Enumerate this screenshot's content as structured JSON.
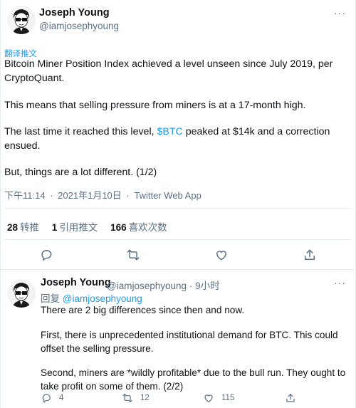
{
  "colors": {
    "link": "#1d9bf0",
    "secondary_text": "#5b7083",
    "divider": "#e6ecf0"
  },
  "main_tweet": {
    "author_name": "Joseph Young",
    "author_handle": "@iamjosephyoung",
    "translate_label": "翻译推文",
    "text_line1": "Bitcoin Miner Position Index achieved a level unseen since July 2019, per CryptoQuant.",
    "text_line2": "This means that selling pressure from miners is at a 17-month high.",
    "text_line3_before": "The last time it reached this level, ",
    "text_line3_link": "$BTC",
    "text_line3_after": " peaked at $14k and a correction ensued.",
    "text_line4": "But, things are a lot different. (1/2)",
    "time": "下午11:14",
    "date": "2021年1月10日",
    "source": "Twitter Web App",
    "meta_separator": "·",
    "stats": [
      {
        "count": "28",
        "label": "转推"
      },
      {
        "count": "1",
        "label": "引用推文"
      },
      {
        "count": "166",
        "label": "喜欢次数"
      }
    ],
    "actions": [
      "reply-icon",
      "retweet-icon",
      "like-icon",
      "share-icon"
    ]
  },
  "reply_tweet": {
    "author_name": "Joseph Young",
    "author_handle": "@iamjosephyoung",
    "separator": "·",
    "age": "9小时",
    "replying_prefix": "回复",
    "replying_to": "@iamjosephyoung",
    "paragraphs": [
      "There are 2 big differences since then and now.",
      "First, there is unprecedented institutional demand for BTC. This could offset the selling pressure.",
      "Second, miners are *wildly profitable* due to the bull run. They ought to take profit on some of them. (2/2)"
    ],
    "reply_count": "4",
    "retweet_count": "12",
    "like_count": "115"
  }
}
